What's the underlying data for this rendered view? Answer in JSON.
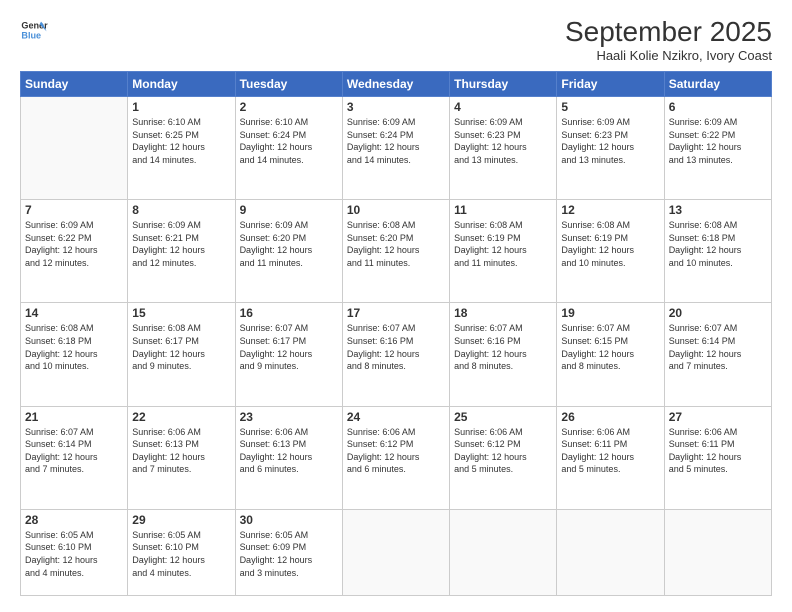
{
  "logo": {
    "line1": "General",
    "line2": "Blue"
  },
  "title": "September 2025",
  "subtitle": "Haali Kolie Nzikro, Ivory Coast",
  "header_days": [
    "Sunday",
    "Monday",
    "Tuesday",
    "Wednesday",
    "Thursday",
    "Friday",
    "Saturday"
  ],
  "weeks": [
    [
      {
        "day": "",
        "info": ""
      },
      {
        "day": "1",
        "info": "Sunrise: 6:10 AM\nSunset: 6:25 PM\nDaylight: 12 hours\nand 14 minutes."
      },
      {
        "day": "2",
        "info": "Sunrise: 6:10 AM\nSunset: 6:24 PM\nDaylight: 12 hours\nand 14 minutes."
      },
      {
        "day": "3",
        "info": "Sunrise: 6:09 AM\nSunset: 6:24 PM\nDaylight: 12 hours\nand 14 minutes."
      },
      {
        "day": "4",
        "info": "Sunrise: 6:09 AM\nSunset: 6:23 PM\nDaylight: 12 hours\nand 13 minutes."
      },
      {
        "day": "5",
        "info": "Sunrise: 6:09 AM\nSunset: 6:23 PM\nDaylight: 12 hours\nand 13 minutes."
      },
      {
        "day": "6",
        "info": "Sunrise: 6:09 AM\nSunset: 6:22 PM\nDaylight: 12 hours\nand 13 minutes."
      }
    ],
    [
      {
        "day": "7",
        "info": "Sunrise: 6:09 AM\nSunset: 6:22 PM\nDaylight: 12 hours\nand 12 minutes."
      },
      {
        "day": "8",
        "info": "Sunrise: 6:09 AM\nSunset: 6:21 PM\nDaylight: 12 hours\nand 12 minutes."
      },
      {
        "day": "9",
        "info": "Sunrise: 6:09 AM\nSunset: 6:20 PM\nDaylight: 12 hours\nand 11 minutes."
      },
      {
        "day": "10",
        "info": "Sunrise: 6:08 AM\nSunset: 6:20 PM\nDaylight: 12 hours\nand 11 minutes."
      },
      {
        "day": "11",
        "info": "Sunrise: 6:08 AM\nSunset: 6:19 PM\nDaylight: 12 hours\nand 11 minutes."
      },
      {
        "day": "12",
        "info": "Sunrise: 6:08 AM\nSunset: 6:19 PM\nDaylight: 12 hours\nand 10 minutes."
      },
      {
        "day": "13",
        "info": "Sunrise: 6:08 AM\nSunset: 6:18 PM\nDaylight: 12 hours\nand 10 minutes."
      }
    ],
    [
      {
        "day": "14",
        "info": "Sunrise: 6:08 AM\nSunset: 6:18 PM\nDaylight: 12 hours\nand 10 minutes."
      },
      {
        "day": "15",
        "info": "Sunrise: 6:08 AM\nSunset: 6:17 PM\nDaylight: 12 hours\nand 9 minutes."
      },
      {
        "day": "16",
        "info": "Sunrise: 6:07 AM\nSunset: 6:17 PM\nDaylight: 12 hours\nand 9 minutes."
      },
      {
        "day": "17",
        "info": "Sunrise: 6:07 AM\nSunset: 6:16 PM\nDaylight: 12 hours\nand 8 minutes."
      },
      {
        "day": "18",
        "info": "Sunrise: 6:07 AM\nSunset: 6:16 PM\nDaylight: 12 hours\nand 8 minutes."
      },
      {
        "day": "19",
        "info": "Sunrise: 6:07 AM\nSunset: 6:15 PM\nDaylight: 12 hours\nand 8 minutes."
      },
      {
        "day": "20",
        "info": "Sunrise: 6:07 AM\nSunset: 6:14 PM\nDaylight: 12 hours\nand 7 minutes."
      }
    ],
    [
      {
        "day": "21",
        "info": "Sunrise: 6:07 AM\nSunset: 6:14 PM\nDaylight: 12 hours\nand 7 minutes."
      },
      {
        "day": "22",
        "info": "Sunrise: 6:06 AM\nSunset: 6:13 PM\nDaylight: 12 hours\nand 7 minutes."
      },
      {
        "day": "23",
        "info": "Sunrise: 6:06 AM\nSunset: 6:13 PM\nDaylight: 12 hours\nand 6 minutes."
      },
      {
        "day": "24",
        "info": "Sunrise: 6:06 AM\nSunset: 6:12 PM\nDaylight: 12 hours\nand 6 minutes."
      },
      {
        "day": "25",
        "info": "Sunrise: 6:06 AM\nSunset: 6:12 PM\nDaylight: 12 hours\nand 5 minutes."
      },
      {
        "day": "26",
        "info": "Sunrise: 6:06 AM\nSunset: 6:11 PM\nDaylight: 12 hours\nand 5 minutes."
      },
      {
        "day": "27",
        "info": "Sunrise: 6:06 AM\nSunset: 6:11 PM\nDaylight: 12 hours\nand 5 minutes."
      }
    ],
    [
      {
        "day": "28",
        "info": "Sunrise: 6:05 AM\nSunset: 6:10 PM\nDaylight: 12 hours\nand 4 minutes."
      },
      {
        "day": "29",
        "info": "Sunrise: 6:05 AM\nSunset: 6:10 PM\nDaylight: 12 hours\nand 4 minutes."
      },
      {
        "day": "30",
        "info": "Sunrise: 6:05 AM\nSunset: 6:09 PM\nDaylight: 12 hours\nand 3 minutes."
      },
      {
        "day": "",
        "info": ""
      },
      {
        "day": "",
        "info": ""
      },
      {
        "day": "",
        "info": ""
      },
      {
        "day": "",
        "info": ""
      }
    ]
  ]
}
